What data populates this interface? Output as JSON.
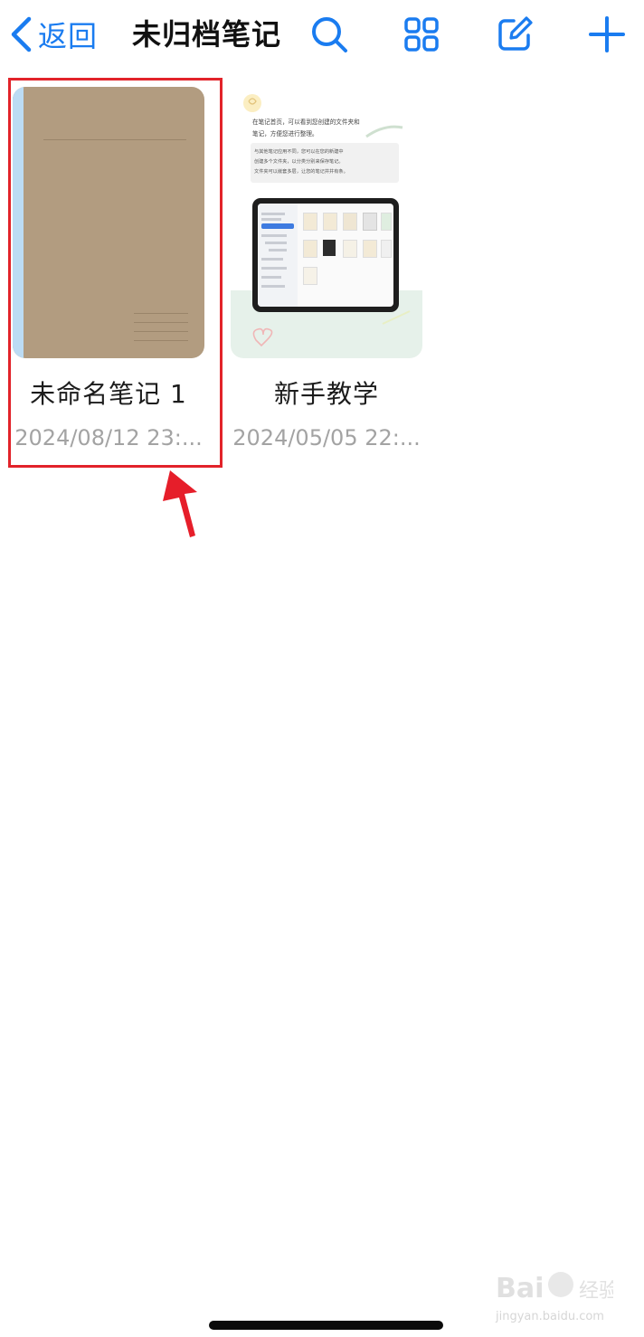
{
  "nav": {
    "back_label": "返回",
    "title": "未归档笔记",
    "accent": "#1a7cf0",
    "icons": [
      "search-icon",
      "grid-view-icon",
      "compose-icon",
      "plus-icon"
    ]
  },
  "notes": [
    {
      "name": "未命名笔记 1",
      "date": "2024/08/12 23:..."
    },
    {
      "name": "新手教学",
      "date": "2024/05/05 22:..."
    }
  ],
  "tutorial_cover": {
    "text_line_1": "在笔记首页，可以看到您创建的文件夹和",
    "text_line_2": "笔记，方便您进行整理。",
    "box_line_1": "与其他笔记应用不同，您可以在您的新建中",
    "box_line_2": "创建多个文件夹，以分类分别来保存笔记。",
    "box_line_3": "文件夹可以嵌套多层，让您的笔记井井有条。"
  },
  "watermark": {
    "brand": "Bai du 经验",
    "url": "jingyan.baidu.com"
  },
  "highlight_color": "#e2232a"
}
